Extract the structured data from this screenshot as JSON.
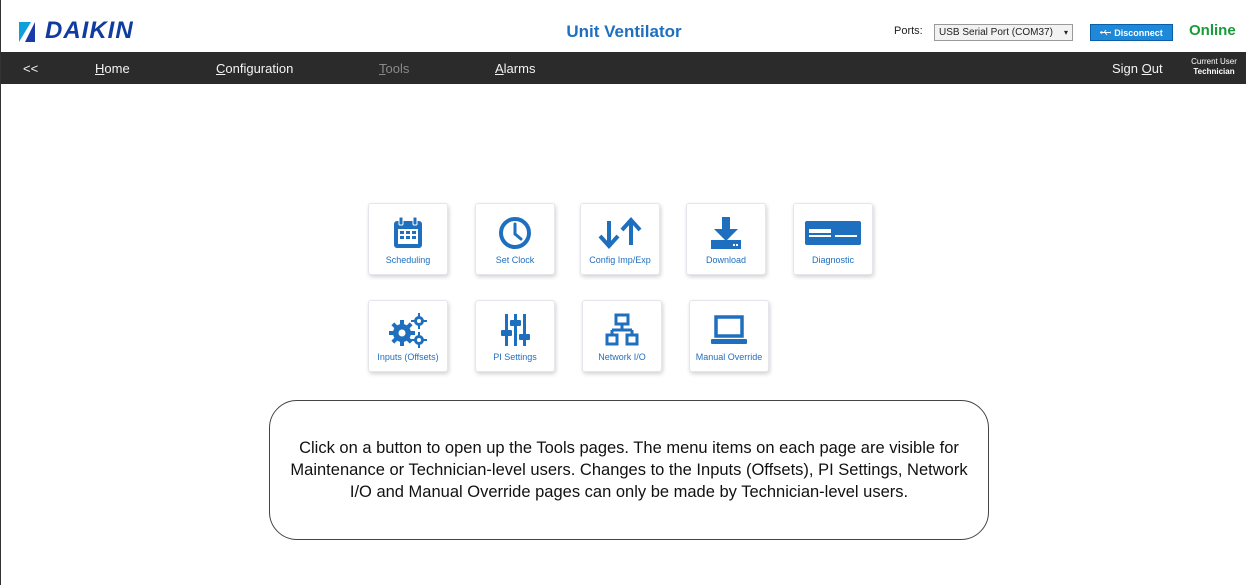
{
  "header": {
    "brand": "DAIKIN",
    "app_title": "Unit Ventilator",
    "ports_label": "Ports:",
    "port_value": "USB Serial Port (COM37)",
    "disconnect_label": "Disconnect",
    "status": "Online"
  },
  "nav": {
    "back": "<<",
    "home": "Home",
    "configuration": "Configuration",
    "tools": "Tools",
    "alarms": "Alarms",
    "sign_out": "Sign Out",
    "current_user_label": "Current User",
    "current_user": "Technician"
  },
  "tools": [
    {
      "label": "Scheduling",
      "icon": "calendar-icon"
    },
    {
      "label": "Set Clock",
      "icon": "clock-icon"
    },
    {
      "label": "Config Imp/Exp",
      "icon": "import-export-icon"
    },
    {
      "label": "Download",
      "icon": "download-icon"
    },
    {
      "label": "Diagnostic",
      "icon": "diagnostic-icon"
    },
    {
      "label": "Inputs (Offsets)",
      "icon": "gears-icon"
    },
    {
      "label": "PI Settings",
      "icon": "sliders-icon"
    },
    {
      "label": "Network I/O",
      "icon": "network-icon"
    },
    {
      "label": "Manual Override",
      "icon": "laptop-icon"
    }
  ],
  "callout": {
    "text": "Click on a button to open up the Tools pages. The menu items on each page are visible for Maintenance or Technician-level users. Changes to the Inputs (Offsets), PI Settings, Network I/O and Manual Override pages can only be made by Technician-level users."
  },
  "colors": {
    "accent": "#1f6fbf",
    "nav_bg": "#2b2b2b",
    "online": "#1a9b3a",
    "disconnect": "#1e88d9"
  }
}
